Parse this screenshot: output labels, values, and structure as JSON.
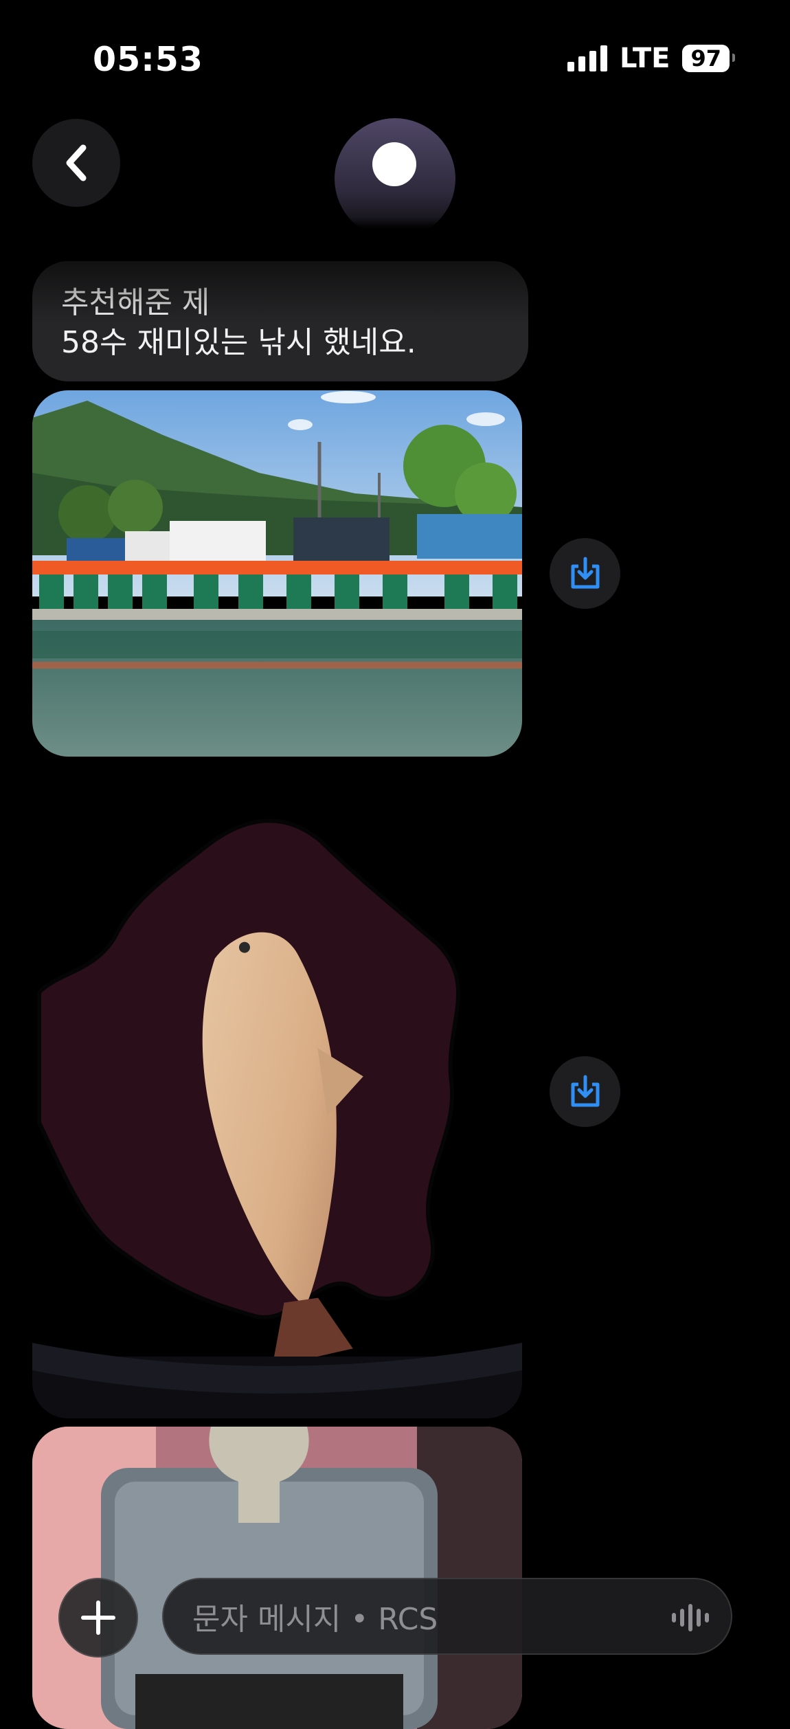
{
  "status_bar": {
    "time": "05:53",
    "network": "LTE",
    "battery": "97"
  },
  "header": {
    "back_icon": "chevron-left-icon",
    "avatar_icon": "contact-avatar"
  },
  "message": {
    "text": "추천해준 제\n58수 재미있는 낚시 했네요."
  },
  "attachments": [
    {
      "kind": "photo",
      "subject": "fishing pond"
    },
    {
      "kind": "photo",
      "subject": "crucian carp in landing net"
    },
    {
      "kind": "photo",
      "subject": "tally counter"
    }
  ],
  "composer": {
    "placeholder": "문자 메시지 • RCS",
    "add_icon": "plus-icon",
    "voice_icon": "waveform-icon"
  },
  "colors": {
    "background": "#000000",
    "bubble": "#262628",
    "accent": "#2f8ff5"
  }
}
